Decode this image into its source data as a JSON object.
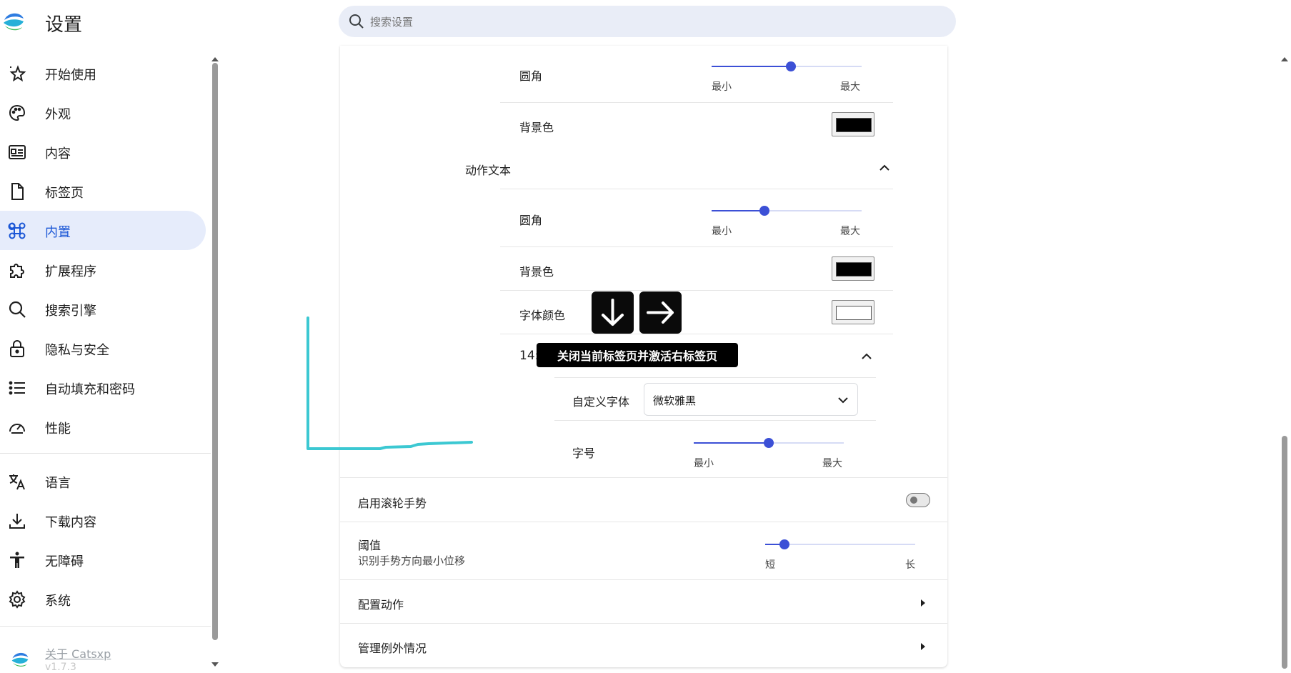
{
  "app": {
    "title": "设置"
  },
  "search": {
    "placeholder": "搜索设置"
  },
  "sidebar": {
    "items": [
      {
        "label": "开始使用",
        "icon": "sparkle-star-icon"
      },
      {
        "label": "外观",
        "icon": "palette-icon"
      },
      {
        "label": "内容",
        "icon": "content-layout-icon"
      },
      {
        "label": "标签页",
        "icon": "document-tab-icon"
      },
      {
        "label": "内置",
        "icon": "command-key-icon",
        "active": true
      },
      {
        "label": "扩展程序",
        "icon": "puzzle-icon"
      },
      {
        "label": "搜索引擎",
        "icon": "search-icon"
      },
      {
        "label": "隐私与安全",
        "icon": "lock-icon"
      },
      {
        "label": "自动填充和密码",
        "icon": "list-checks-icon"
      },
      {
        "label": "性能",
        "icon": "speedometer-icon"
      },
      {
        "label": "语言",
        "icon": "translate-icon"
      },
      {
        "label": "下载内容",
        "icon": "download-icon"
      },
      {
        "label": "无障碍",
        "icon": "accessibility-icon"
      },
      {
        "label": "系统",
        "icon": "gear-icon"
      }
    ],
    "about": "关于 Catsxp",
    "version": "v1.7.3"
  },
  "main": {
    "corner_label_1": "圆角",
    "slider_min": "最小",
    "slider_max": "最大",
    "bg_color_label": "背景色",
    "action_text_section": "动作文本",
    "corner_label_2": "圆角",
    "bg_color_label_2": "背景色",
    "font_color_label": "字体颜色",
    "font_size_row_prefix": "14:",
    "custom_font_label": "自定义字体",
    "custom_font_value": "微软雅黑",
    "font_size_label": "字号",
    "wheel_gesture_label": "启用滚轮手势",
    "threshold_label": "阈值",
    "threshold_desc": "识别手势方向最小位移",
    "threshold_min": "短",
    "threshold_max": "长",
    "configure_actions": "配置动作",
    "manage_exceptions": "管理例外情况"
  },
  "sliders": {
    "corner_1": 0.53,
    "corner_2": 0.35,
    "font_size": 0.5,
    "threshold": 0.13
  },
  "colors": {
    "accent": "#3c50d6",
    "active_nav_bg": "#e6ecfb",
    "active_nav_text": "#1a56d6",
    "swatch_black": "#000000",
    "swatch_white": "#ffffff",
    "gesture_trail": "#3cc8d2"
  },
  "overlay": {
    "gesture_arrows": [
      "arrow-down-icon",
      "arrow-right-icon"
    ],
    "tooltip": "关闭当前标签页并激活右标签页"
  }
}
